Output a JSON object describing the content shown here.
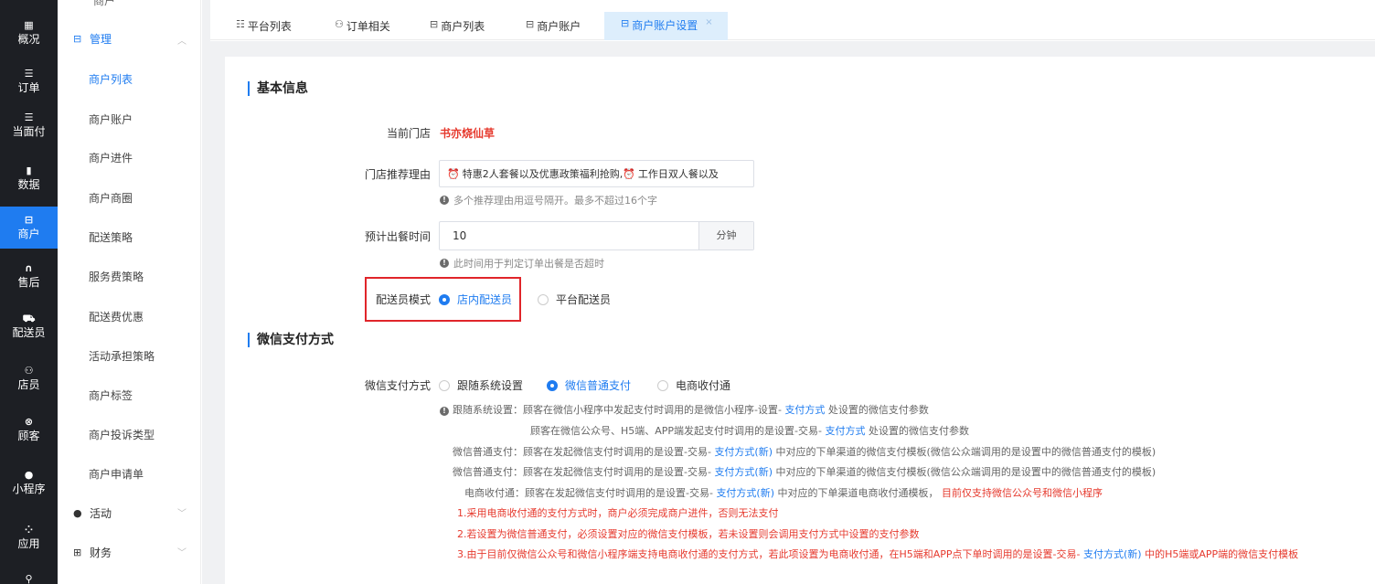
{
  "rail": [
    {
      "icon": "▦",
      "label": "概况",
      "active": false
    },
    {
      "icon": "☰",
      "label": "订单",
      "active": false
    },
    {
      "icon": "☰",
      "label": "当面付",
      "active": false
    },
    {
      "icon": "▮",
      "label": "数据",
      "active": false
    },
    {
      "icon": "⊟",
      "label": "商户",
      "active": true
    },
    {
      "icon": "∩",
      "label": "售后",
      "active": false
    },
    {
      "icon": "⛟",
      "label": "配送员",
      "active": false
    },
    {
      "icon": "⚇",
      "label": "店员",
      "active": false
    },
    {
      "icon": "⊗",
      "label": "顾客",
      "active": false
    },
    {
      "icon": "●",
      "label": "小程序",
      "active": false
    },
    {
      "icon": "⁘",
      "label": "应用",
      "active": false
    },
    {
      "icon": "⚲",
      "label": "",
      "active": false
    }
  ],
  "submenu": {
    "clipped_top": "商户",
    "group_manage": "管理",
    "items": [
      "商户列表",
      "商户账户",
      "商户进件",
      "商户商圈",
      "配送策略",
      "服务费策略",
      "配送费优惠",
      "活动承担策略",
      "商户标签",
      "商户投诉类型",
      "商户申请单"
    ],
    "group_activity": "活动",
    "group_finance": "财务"
  },
  "tabs": [
    {
      "icon": "☷",
      "label": "平台列表"
    },
    {
      "icon": "⚇",
      "label": "订单相关"
    },
    {
      "icon": "⊟",
      "label": "商户列表"
    },
    {
      "icon": "⊟",
      "label": "商户账户"
    },
    {
      "icon": "⊟",
      "label": "商户账户设置",
      "close": "×"
    }
  ],
  "basic": {
    "title": "基本信息",
    "store_label": "当前门店",
    "store_name": "书亦烧仙草",
    "reason_label": "门店推荐理由",
    "reason_part1": "特惠2人套餐以及优惠政策福利抢购,",
    "reason_part2": "工作日双人餐以及",
    "reason_hint": "多个推荐理由用逗号隔开。最多不超过16个字",
    "time_label": "预计出餐时间",
    "time_value": "10",
    "time_unit": "分钟",
    "time_hint": "此时间用于判定订单出餐是否超时",
    "courier_label": "配送员模式",
    "courier_opt1": "店内配送员",
    "courier_opt2": "平台配送员"
  },
  "pay": {
    "title": "微信支付方式",
    "label": "微信支付方式",
    "opt1": "跟随系统设置",
    "opt2": "微信普通支付",
    "opt3": "电商收付通",
    "n1a": "跟随系统设置：顾客在微信小程序中发起支付时调用的是微信小程序-设置- ",
    "n1link": "支付方式",
    "n1b": " 处设置的微信支付参数",
    "n2a": "顾客在微信公众号、H5端、APP端发起支付时调用的是设置-交易- ",
    "n2link": "支付方式",
    "n2b": " 处设置的微信支付参数",
    "n3a": "微信普通支付：顾客在发起微信支付时调用的是设置-交易- ",
    "n3link": "支付方式(新)",
    "n3b": " 中对应的下单渠道的微信支付模板(微信公众端调用的是设置中的微信普通支付的模板)",
    "n5a": "电商收付通：顾客在发起微信支付时调用的是设置-交易- ",
    "n5link": "支付方式(新)",
    "n5b": " 中对应的下单渠道电商收付通模板，",
    "n5red": " 目前仅支持微信公众号和微信小程序",
    "r1": "1.采用电商收付通的支付方式时，商户必须完成商户进件，否则无法支付",
    "r2": "2.若设置为微信普通支付，必须设置对应的微信支付模板，若未设置则会调用支付方式中设置的支付参数",
    "r3a": "3.由于目前仅微信公众号和微信小程序端支持电商收付通的支付方式，若此项设置为电商收付通，在H5端和APP点下单时调用的是设置-交易- ",
    "r3link": "支付方式(新)",
    "r3b": " 中的H5端或APP端的微信支付模板"
  },
  "colors": {
    "accent": "#1f7cf0",
    "danger": "#e63a2e",
    "rail_bg": "#1d1f24"
  }
}
